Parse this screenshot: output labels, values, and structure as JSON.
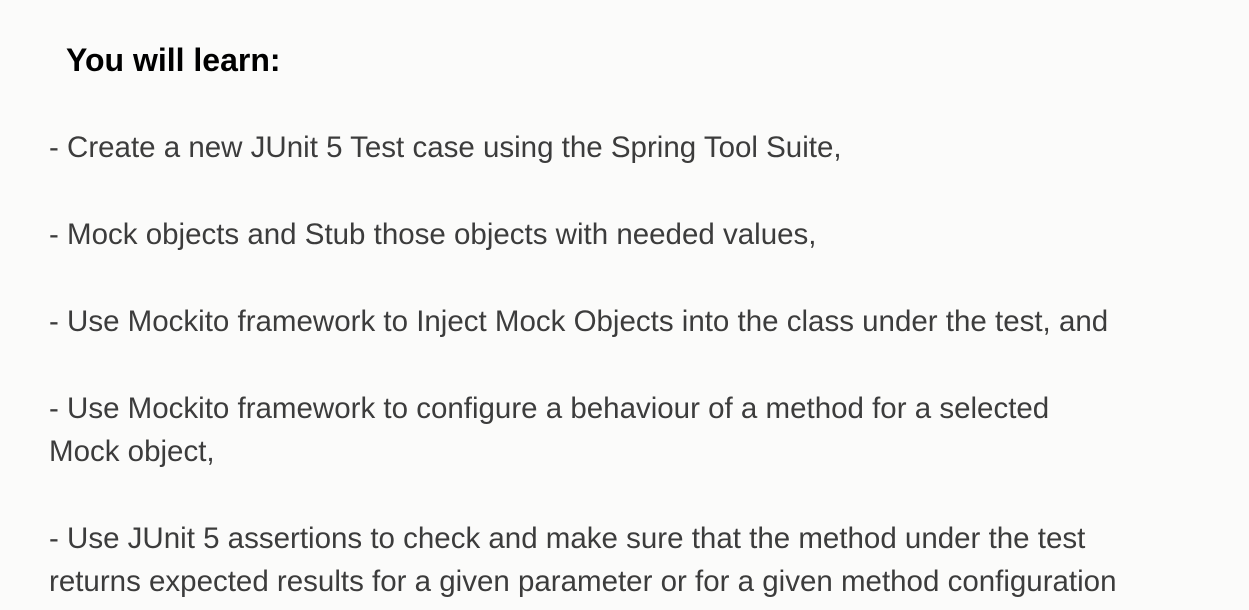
{
  "heading": "You will learn:",
  "items": [
    {
      "lines": [
        "- Create a new JUnit 5 Test case using the Spring Tool Suite,"
      ]
    },
    {
      "lines": [
        "- Mock objects and Stub those objects with needed values,"
      ]
    },
    {
      "lines": [
        "- Use Mockito framework to Inject Mock Objects into the class under the test, and"
      ]
    },
    {
      "lines": [
        "- Use Mockito framework to configure a behaviour of a method for a selected",
        "Mock object,"
      ]
    },
    {
      "lines": [
        "- Use JUnit 5 assertions to check and make sure that the method under the test",
        "returns expected results for a given parameter or for a given method configuration"
      ]
    }
  ]
}
